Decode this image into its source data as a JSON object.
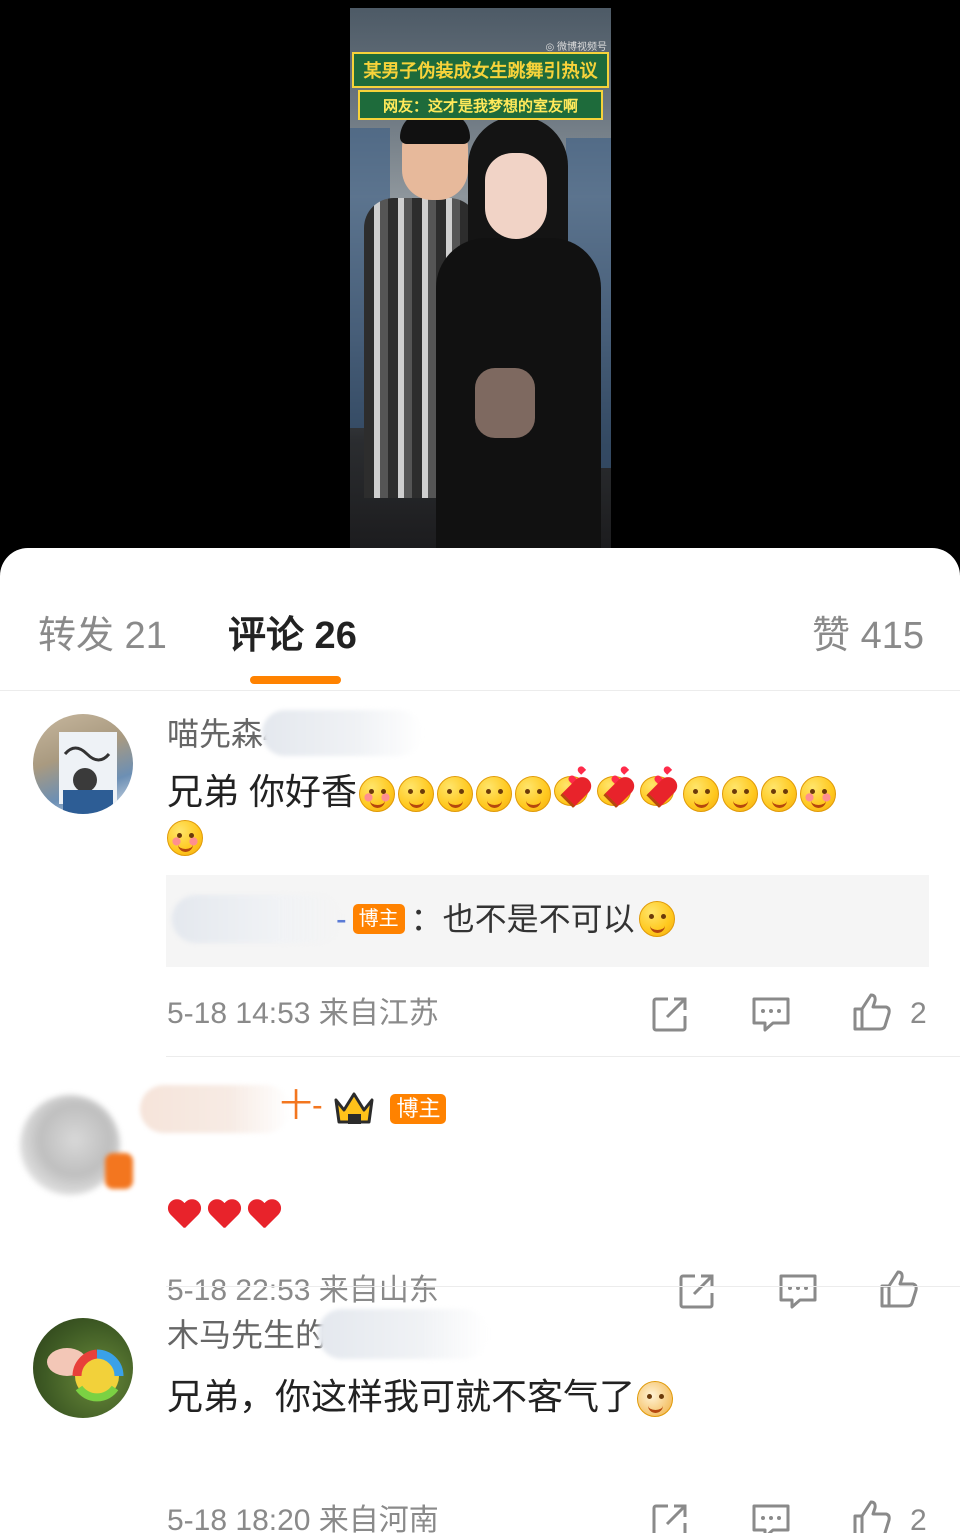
{
  "video": {
    "watermark": "◎ 微博视频号",
    "title": "某男子伪装成女生跳舞引热议",
    "subtitle": "网友：这才是我梦想的室友啊"
  },
  "tabs": {
    "repost": "转发 21",
    "comment": "评论 26",
    "like": "赞 415"
  },
  "colors": {
    "accent": "#ff8200",
    "muted_text": "#8a8a8a"
  },
  "comments": [
    {
      "username_visible": "喵先森4",
      "text": "兄弟 你好香",
      "emoji_count": 13,
      "reply": {
        "separator": "-",
        "badge": "博主",
        "text": "：也不是不可以"
      },
      "meta": "5-18 14:53 来自江苏",
      "like_count": "2"
    },
    {
      "username_visible": "十-",
      "badge": "博主",
      "text_hearts": 3,
      "meta": "5-18 22:53 来自山东",
      "like_count": ""
    },
    {
      "username_visible": "木马先生的",
      "text": "兄弟，你这样我可就不客气了",
      "meta": "5-18 18:20 来自河南",
      "like_count": "2"
    }
  ],
  "icons": {
    "repost": "share-icon",
    "reply": "comment-icon",
    "like": "thumb-up-icon"
  }
}
